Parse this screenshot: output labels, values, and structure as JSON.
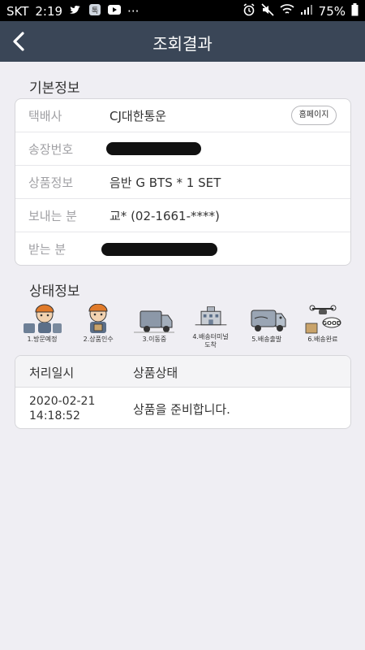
{
  "statusbar": {
    "carrier": "SKT",
    "time": "2:19",
    "dots": "···",
    "battery": "75%"
  },
  "appbar": {
    "title": "조회결과"
  },
  "basic": {
    "section_title": "기본정보",
    "rows": [
      {
        "label": "택배사",
        "value": "CJ대한통운"
      },
      {
        "label": "송장번호",
        "value": ""
      },
      {
        "label": "상품정보",
        "value": "음반 G BTS * 1 SET"
      },
      {
        "label": "보내는 분",
        "value": "교* (02-1661-****)"
      },
      {
        "label": "받는 분",
        "value": ""
      }
    ],
    "homepage_button": "홈페이지"
  },
  "status": {
    "section_title": "상태정보",
    "steps": [
      {
        "label": "1.방문예정"
      },
      {
        "label": "2.상품인수"
      },
      {
        "label": "3.이동중"
      },
      {
        "label": "4.배송터미널\n도착"
      },
      {
        "label": "5.배송출발"
      },
      {
        "label": "6.배송완료"
      }
    ],
    "table": {
      "col_datetime": "처리일시",
      "col_status": "상품상태",
      "date": "2020-02-21",
      "time": "14:18:52",
      "state": "상품을 준비합니다."
    }
  }
}
